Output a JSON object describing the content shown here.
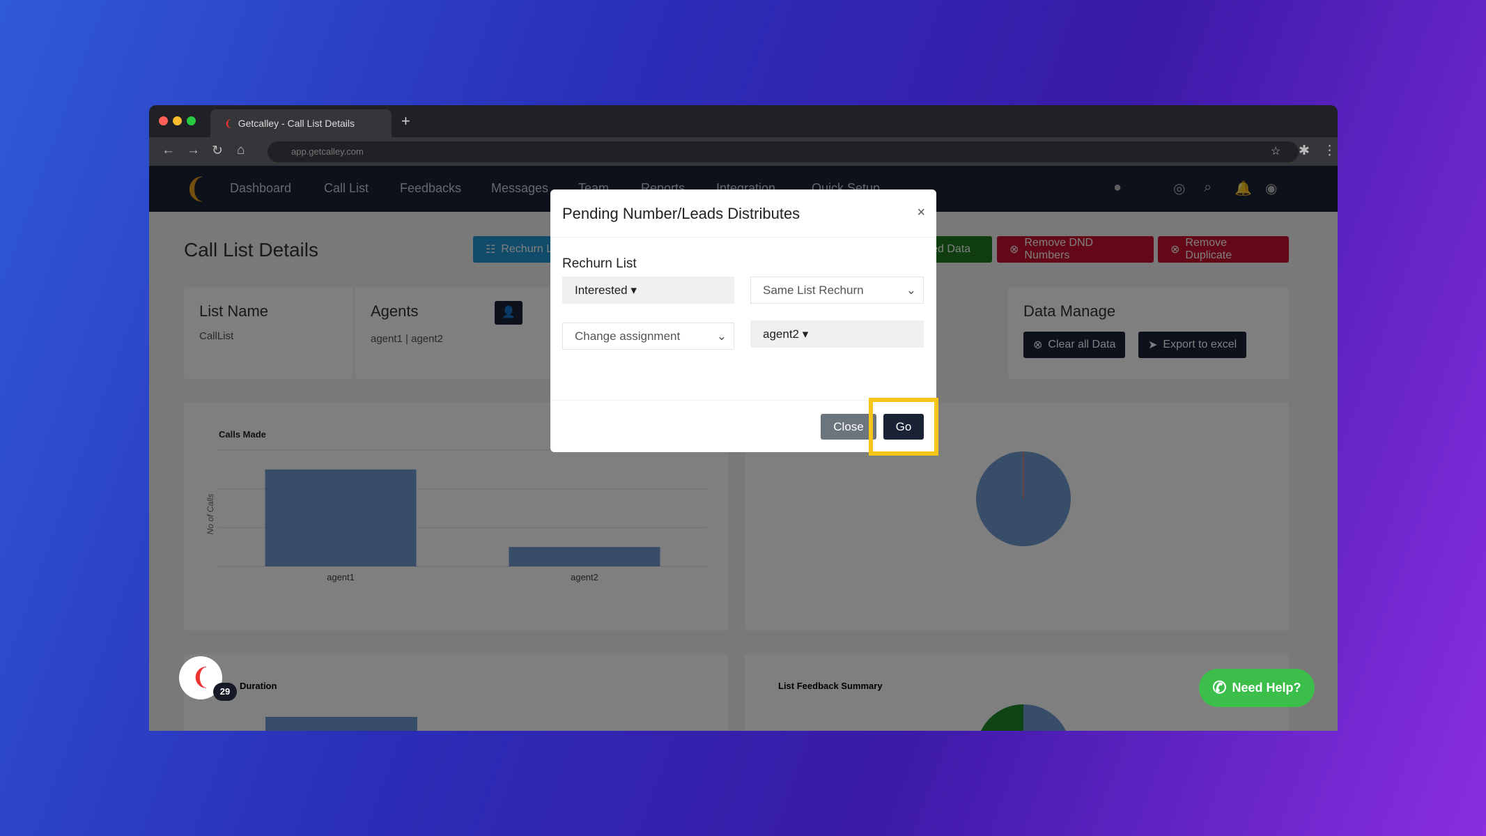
{
  "browser": {
    "tab_title": "Getcalley - Call List Details",
    "url": "app.getcalley.com"
  },
  "nav": {
    "items": [
      "Dashboard",
      "Call List",
      "Feedbacks",
      "Messages",
      "Team",
      "Reports",
      "Integration",
      "Quick Setup"
    ],
    "icons": [
      "android-icon",
      "apple-icon",
      "support-icon",
      "search-icon",
      "bell-icon",
      "user-icon"
    ]
  },
  "page": {
    "title": "Call List Details",
    "actions": {
      "rechurn": "Rechurn List",
      "combined": "Combined Data",
      "remove_dnd": "Remove DND Numbers",
      "remove_dup": "Remove Duplicate"
    },
    "list_name": {
      "label": "List Name",
      "value": "CallList"
    },
    "agents": {
      "label": "Agents",
      "value": "agent1 | agent2"
    },
    "data_manage": {
      "label": "Data Manage",
      "clear": "Clear all Data",
      "export": "Export to excel"
    },
    "duration_title": "Duration",
    "feedback_title": "List Feedback Summary"
  },
  "chart_data": {
    "type": "bar",
    "title": "Calls Made",
    "ylabel": "No of Calls",
    "categories": [
      "agent1",
      "agent2"
    ],
    "values": [
      5,
      1
    ],
    "ylim": [
      0,
      6
    ],
    "grid": true,
    "color": "#6f9bd1"
  },
  "modal": {
    "title": "Pending Number/Leads Distributes",
    "section": "Rechurn List",
    "status_select": "Interested",
    "rechurn_select": "Same List Rechurn",
    "assign_select": "Change assignment",
    "agent_select": "agent2",
    "close": "Close",
    "go": "Go"
  },
  "help": {
    "label": "Need Help?",
    "badge": "29"
  },
  "colors": {
    "accent": "#1a2236",
    "danger": "#c8102e",
    "success": "#1f7a1f",
    "info": "#2196d3",
    "highlight": "#f5c518"
  }
}
